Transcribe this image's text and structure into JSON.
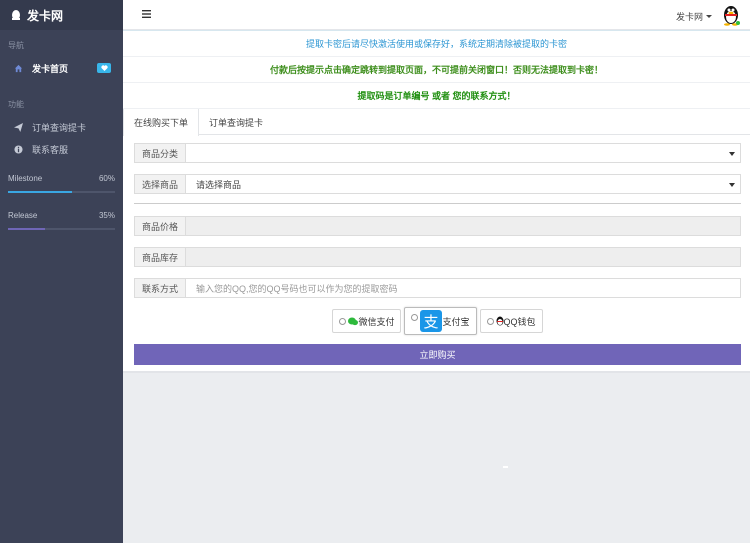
{
  "brand": {
    "title": "发卡网"
  },
  "sidebar": {
    "nav_heading": "导航",
    "items": [
      {
        "label": "发卡首页",
        "icon": "home-icon"
      }
    ],
    "func_heading": "功能",
    "func_items": [
      {
        "label": "订单查询提卡",
        "icon": "send-icon"
      },
      {
        "label": "联系客服",
        "icon": "info-icon"
      }
    ],
    "progress": [
      {
        "label": "Milestone",
        "value": "60%",
        "fraction": 0.6,
        "color": "#3aa7e3"
      },
      {
        "label": "Release",
        "value": "35%",
        "fraction": 0.35,
        "color": "#6f66b6"
      }
    ]
  },
  "header": {
    "user_label": "发卡网"
  },
  "notices": [
    {
      "text": "提取卡密后请尽快激活使用或保存好，系统定期清除被提取的卡密",
      "color": "#2c96d3"
    },
    {
      "text": "付款后按提示点击确定跳转到提取页面，不可提前关闭窗口！否则无法提取到卡密！",
      "color": "#3f8f1e"
    },
    {
      "text": "提取码是订单编号 或者 您的联系方式！",
      "color": "#1f8f0f"
    }
  ],
  "tabs": [
    {
      "label": "在线购买下单"
    },
    {
      "label": "订单查询提卡"
    }
  ],
  "form": {
    "category_label": "商品分类",
    "category_value": "",
    "product_label": "选择商品",
    "product_value": "请选择商品",
    "price_label": "商品价格",
    "price_value": "",
    "stock_label": "商品库存",
    "stock_value": "",
    "contact_label": "联系方式",
    "contact_placeholder": "输入您的QQ,您的QQ号码也可以作为您的提取密码"
  },
  "payments": [
    {
      "label": "微信支付",
      "icon": "wechat-icon"
    },
    {
      "label": "支付宝",
      "icon": "alipay-icon"
    },
    {
      "label": "QQ钱包",
      "icon": "qq-icon"
    }
  ],
  "buy_button": "立即购买",
  "colors": {
    "accent": "#7065b8",
    "sidebar": "#3c4257"
  }
}
